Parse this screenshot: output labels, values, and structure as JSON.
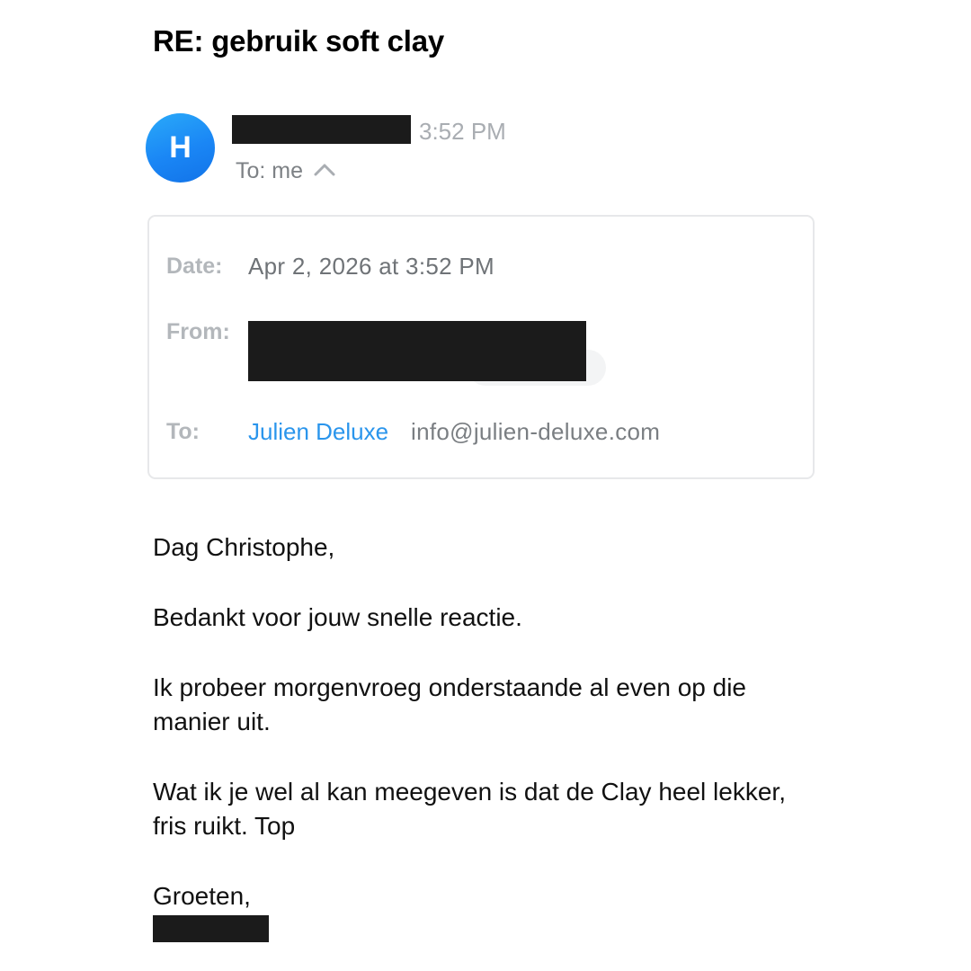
{
  "email": {
    "subject": "RE: gebruik soft clay",
    "avatar_initial": "H",
    "time": "3:52 PM",
    "recipient_summary": "To: me",
    "toggle_icon": "chevron-up-icon",
    "details": {
      "date_label": "Date:",
      "date_value": "Apr 2, 2026 at 3:52 PM",
      "from_label": "From:",
      "to_label": "To:",
      "to_name": "Julien Deluxe",
      "to_email": "info@julien-deluxe.com"
    },
    "body": {
      "greeting": "Dag Christophe,",
      "paragraph_1": "Bedankt voor jouw snelle reactie.",
      "paragraph_2": "Ik probeer morgenvroeg onderstaande al even op die manier uit.",
      "paragraph_3": "Wat ik je wel al kan meegeven is dat de Clay heel lekker, fris ruikt. Top",
      "closing": "Groeten,"
    }
  },
  "colors": {
    "avatar": "#1a86f5",
    "link": "#2a95ec",
    "muted_text": "#7d8185",
    "redaction": "#1b1b1b"
  }
}
